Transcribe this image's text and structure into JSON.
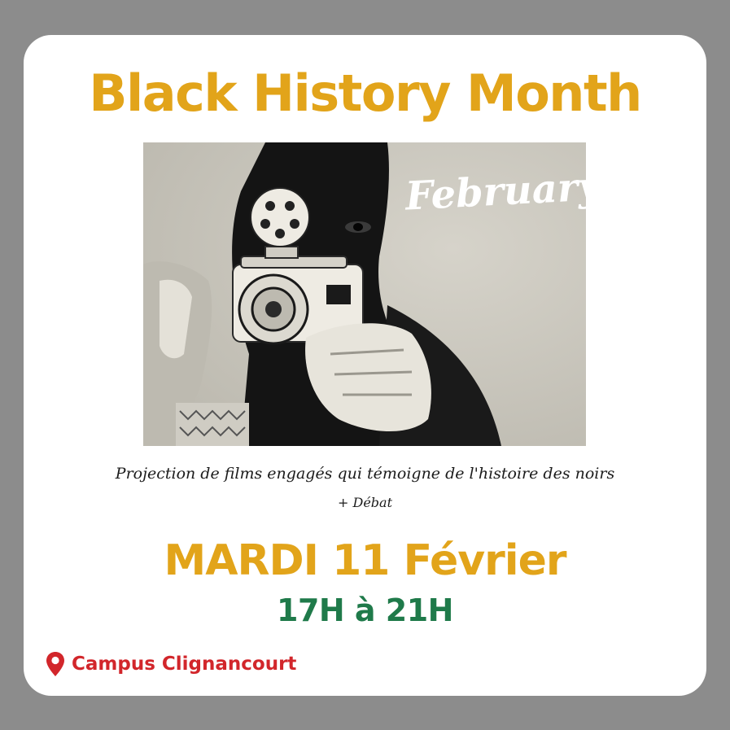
{
  "poster": {
    "title": "Black History Month",
    "month_script": "February",
    "description_line1": "Projection de films engagés qui témoigne de l'histoire des noirs",
    "description_line2": "+ Débat",
    "date": "MARDI 11 Février",
    "hours": "17H à 21H",
    "location": "Campus Clignancourt",
    "location_icon": "map-pin-icon"
  },
  "colors": {
    "background": "#8c8c8c",
    "card": "#ffffff",
    "title_gold": "#e2a41a",
    "hours_green": "#1f7a4a",
    "location_red": "#d2262b"
  }
}
